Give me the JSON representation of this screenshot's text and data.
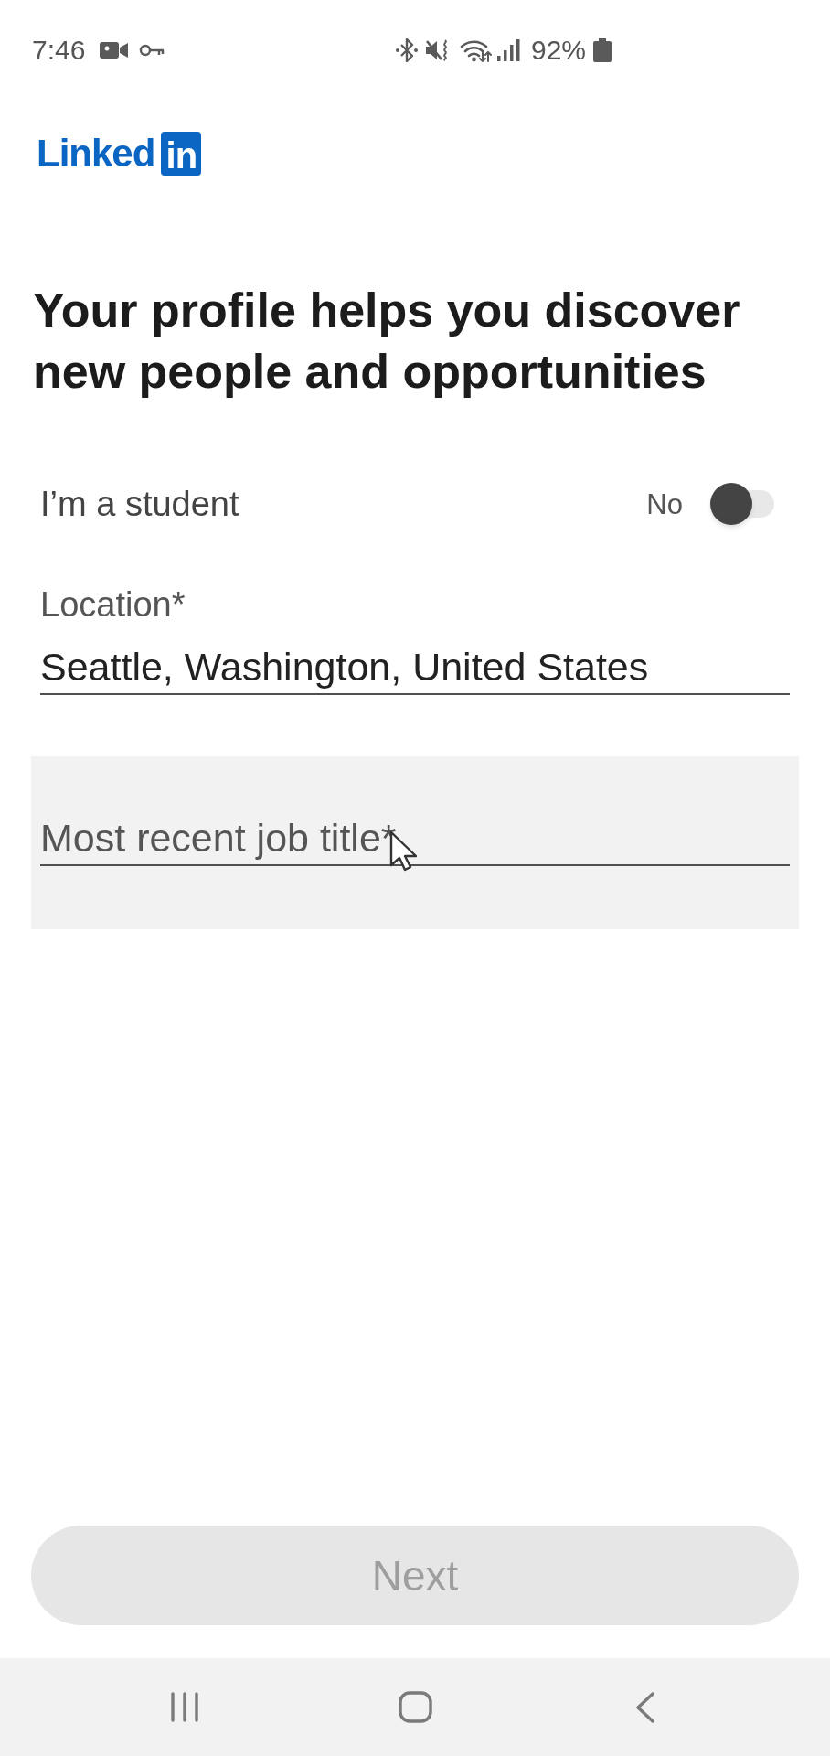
{
  "status_bar": {
    "time": "7:46",
    "battery": "92%"
  },
  "logo": {
    "wordmark": "Linked",
    "badge": "in"
  },
  "heading": "Your profile helps you discover new people and opportunities",
  "student": {
    "label": "I’m a student",
    "state_text": "No",
    "on": false
  },
  "location": {
    "label": "Location*",
    "value": "Seattle, Washington, United States"
  },
  "job_title": {
    "placeholder": "Most recent job title*",
    "highlighted": true
  },
  "next_button": {
    "label": "Next",
    "disabled": true
  }
}
